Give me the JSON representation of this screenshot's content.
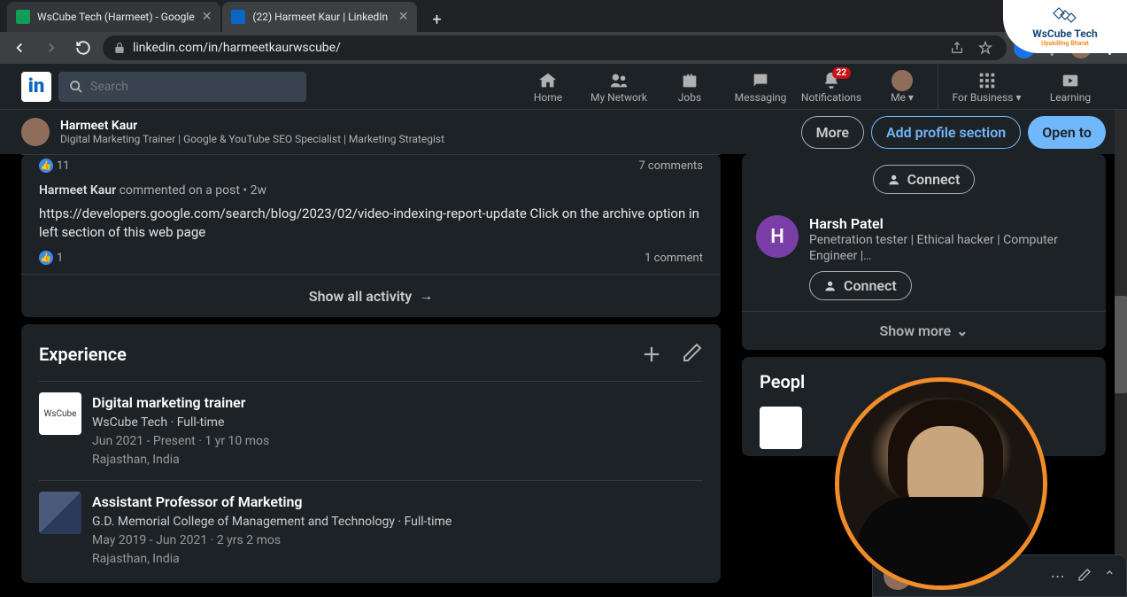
{
  "browser": {
    "tabs": [
      {
        "title": "WsCube Tech (Harmeet) - Google"
      },
      {
        "title": "(22) Harmeet Kaur | LinkedIn"
      }
    ],
    "url": "linkedin.com/in/harmeetkaurwscube/"
  },
  "overlay_brand": {
    "name": "WsCube Tech",
    "tagline": "Upskilling Bharat"
  },
  "header": {
    "search_placeholder": "Search",
    "nav": {
      "home": "Home",
      "network": "My Network",
      "jobs": "Jobs",
      "messaging": "Messaging",
      "notifications": "Notifications",
      "notifications_badge": "22",
      "me": "Me",
      "business": "For Business",
      "learning": "Learning"
    }
  },
  "sticky": {
    "name": "Harmeet Kaur",
    "title": "Digital Marketing Trainer | Google & YouTube SEO Specialist | Marketing Strategist",
    "more": "More",
    "add_section": "Add profile section",
    "open_to": "Open to"
  },
  "activity": {
    "prev": {
      "reactions": "11",
      "comments": "7 comments"
    },
    "meta_name": "Harmeet Kaur",
    "meta_rest": " commented on a post • 2w",
    "body": "https://developers.google.com/search/blog/2023/02/video-indexing-report-update Click on the archive option in left section of this web page",
    "curr": {
      "reactions": "1",
      "comments": "1 comment"
    },
    "show_all": "Show all activity"
  },
  "experience": {
    "heading": "Experience",
    "items": [
      {
        "role": "Digital marketing trainer",
        "company_line": "WsCube Tech · Full-time",
        "dates": "Jun 2021 - Present · 1 yr 10 mos",
        "location": "Rajasthan, India"
      },
      {
        "role": "Assistant Professor of Marketing",
        "company_line": "G.D. Memorial College of Management and Technology · Full-time",
        "dates": "May 2019 - Jun 2021 · 2 yrs 2 mos",
        "location": "Rajasthan, India"
      }
    ]
  },
  "aside": {
    "connect_label": "Connect",
    "people": [
      {
        "name": "Harsh Patel",
        "title": "Penetration tester | Ethical hacker | Computer Engineer |…"
      }
    ],
    "show_more": "Show more",
    "people_viewed_heading": "Peopl"
  }
}
